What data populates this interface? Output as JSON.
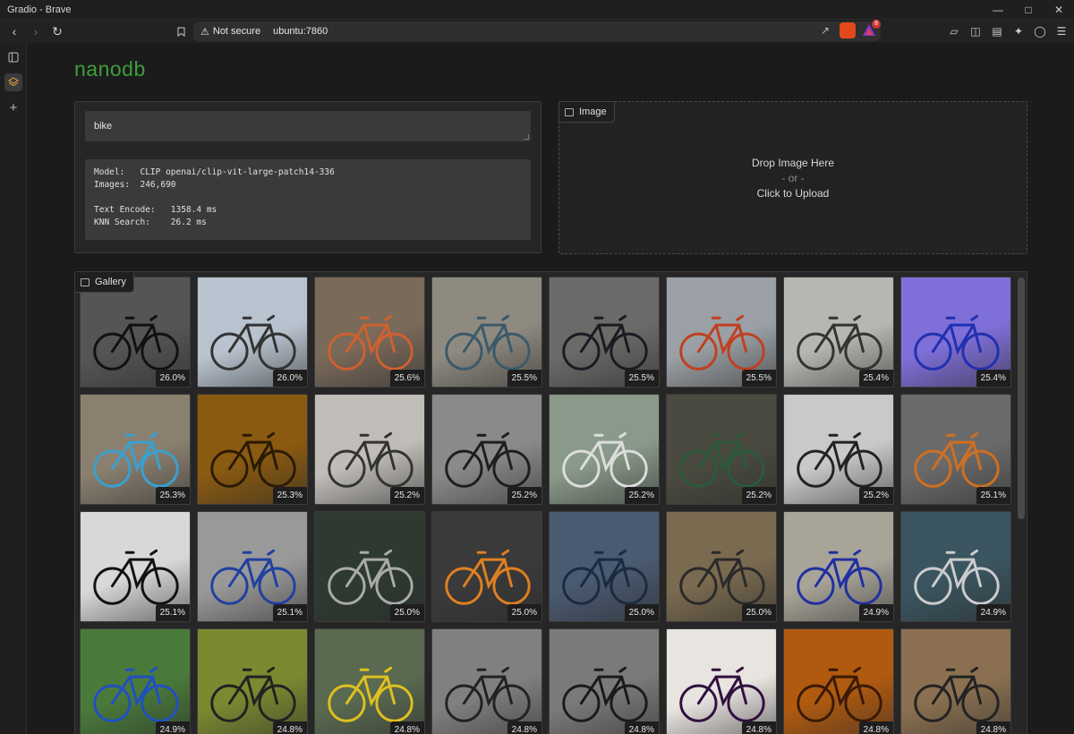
{
  "window": {
    "title": "Gradio - Brave"
  },
  "browser": {
    "security_label": "Not secure",
    "url": "ubuntu:7860",
    "shield_badge": "",
    "rewards_badge": "8"
  },
  "app": {
    "title": "nanodb"
  },
  "query": {
    "text": "bike"
  },
  "stats": {
    "text": "Model:   CLIP openai/clip-vit-large-patch14-336\nImages:  246,690\n\nText Encode:   1358.4 ms\nKNN Search:    26.2 ms"
  },
  "image_input": {
    "label": "Image",
    "drop_line1": "Drop Image Here",
    "drop_or": "- or -",
    "drop_line2": "Click to Upload"
  },
  "gallery": {
    "label": "Gallery",
    "items": [
      {
        "score": "26.0%",
        "bg": "#555",
        "fg": "#111"
      },
      {
        "score": "26.0%",
        "bg": "#b9c3cf",
        "fg": "#333"
      },
      {
        "score": "25.6%",
        "bg": "#7a6a5a",
        "fg": "#d06030"
      },
      {
        "score": "25.5%",
        "bg": "#8f8a80",
        "fg": "#3a5a6a"
      },
      {
        "score": "25.5%",
        "bg": "#6a6a68",
        "fg": "#1a1a22"
      },
      {
        "score": "25.5%",
        "bg": "#9aa0a5",
        "fg": "#c04020"
      },
      {
        "score": "25.4%",
        "bg": "#b8b6b0",
        "fg": "#333"
      },
      {
        "score": "25.4%",
        "bg": "#7f6fd8",
        "fg": "#2030b0"
      },
      {
        "score": "25.3%",
        "bg": "#8a8070",
        "fg": "#3aa0d0"
      },
      {
        "score": "25.3%",
        "bg": "#8a5a10",
        "fg": "#2a1a05"
      },
      {
        "score": "25.2%",
        "bg": "#c0bdb8",
        "fg": "#333"
      },
      {
        "score": "25.2%",
        "bg": "#8a8a88",
        "fg": "#1e1e1e"
      },
      {
        "score": "25.2%",
        "bg": "#8a9a8a",
        "fg": "#ddd"
      },
      {
        "score": "25.2%",
        "bg": "#4a4a40",
        "fg": "#2a5a3a"
      },
      {
        "score": "25.2%",
        "bg": "#c9c9c9",
        "fg": "#222"
      },
      {
        "score": "25.1%",
        "bg": "#6a6a6a",
        "fg": "#d07020"
      },
      {
        "score": "25.1%",
        "bg": "#d8d8d8",
        "fg": "#111"
      },
      {
        "score": "25.1%",
        "bg": "#999999",
        "fg": "#2040a0"
      },
      {
        "score": "25.0%",
        "bg": "#2e3a30",
        "fg": "#aaa"
      },
      {
        "score": "25.0%",
        "bg": "#3a3a3a",
        "fg": "#e08020"
      },
      {
        "score": "25.0%",
        "bg": "#4a5a70",
        "fg": "#1a2a40"
      },
      {
        "score": "25.0%",
        "bg": "#7a6a50",
        "fg": "#2a2a2a"
      },
      {
        "score": "24.9%",
        "bg": "#a8a498",
        "fg": "#2030a0"
      },
      {
        "score": "24.9%",
        "bg": "#3a5560",
        "fg": "#ccc"
      },
      {
        "score": "24.9%",
        "bg": "#4a7a3a",
        "fg": "#2050c0"
      },
      {
        "score": "24.8%",
        "bg": "#7a8a30",
        "fg": "#222"
      },
      {
        "score": "24.8%",
        "bg": "#5a6a50",
        "fg": "#e0c020"
      },
      {
        "score": "24.8%",
        "bg": "#808080",
        "fg": "#222"
      },
      {
        "score": "24.8%",
        "bg": "#7a7a78",
        "fg": "#1a1a1a"
      },
      {
        "score": "24.8%",
        "bg": "#e8e4e0",
        "fg": "#301040"
      },
      {
        "score": "24.8%",
        "bg": "#b05a10",
        "fg": "#3a1a05"
      },
      {
        "score": "24.8%",
        "bg": "#8a7050",
        "fg": "#222"
      }
    ]
  }
}
